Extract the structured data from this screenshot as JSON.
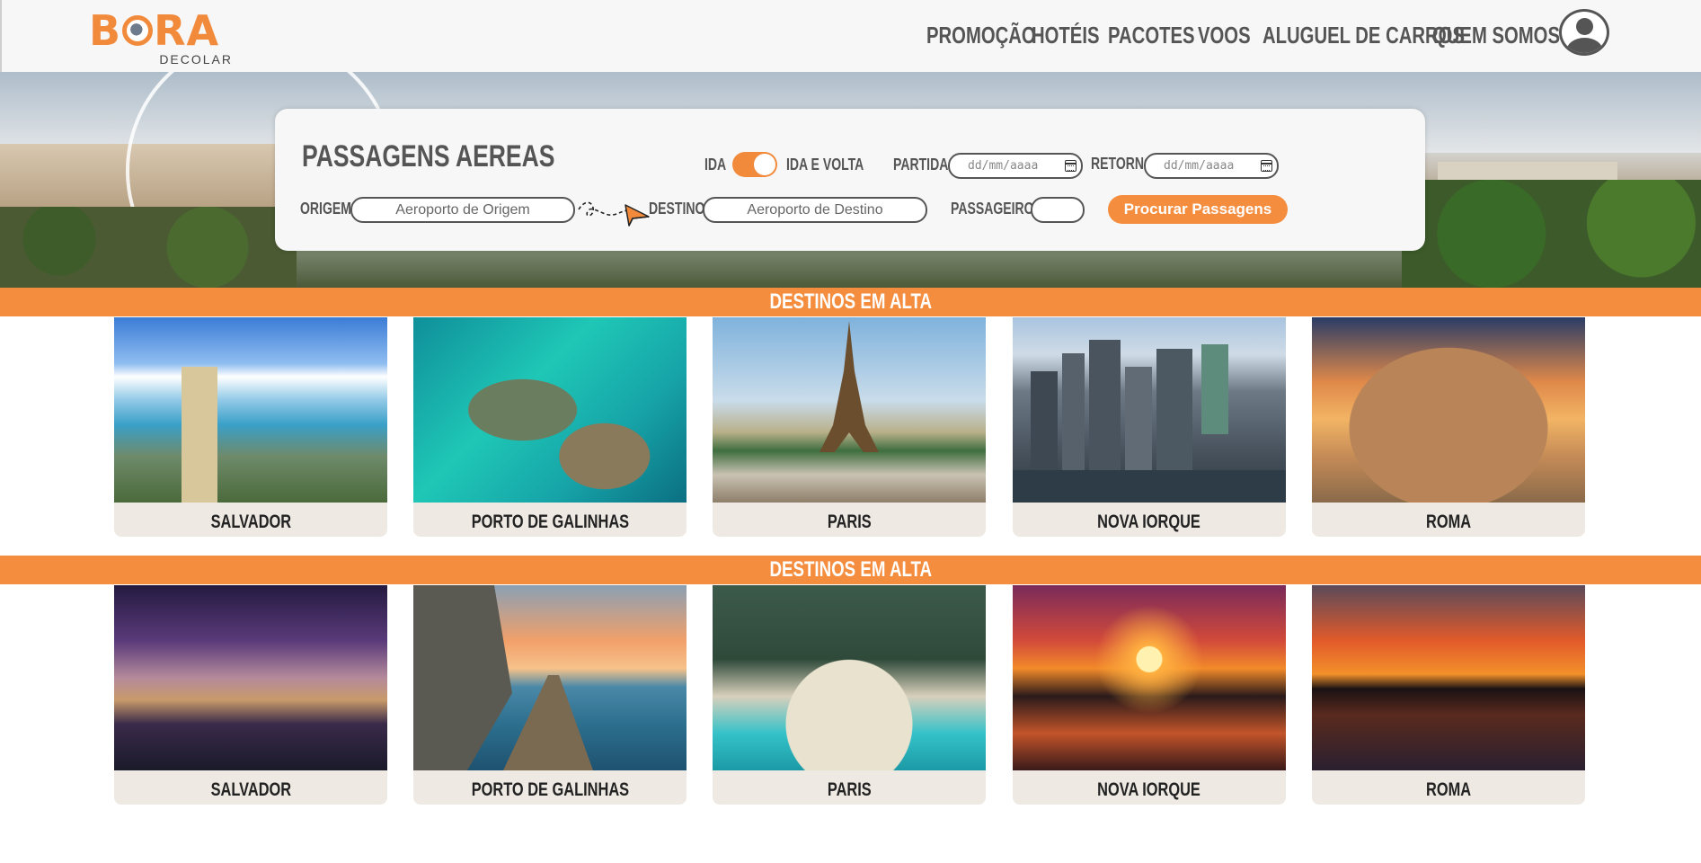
{
  "header": {
    "logo_main_a": "B",
    "logo_main_b": "RA",
    "logo_sub": "DECOLAR",
    "nav": [
      {
        "label": "PROMOÇÃO"
      },
      {
        "label": "HOTÉIS"
      },
      {
        "label": "PACOTES"
      },
      {
        "label": "VOOS"
      },
      {
        "label": "ALUGUEL DE CARROS"
      },
      {
        "label": "QUEM SOMOS"
      }
    ],
    "avatar_icon": "user-icon"
  },
  "search": {
    "title": "PASSAGENS AEREAS",
    "ida_label": "IDA",
    "ida_volta_label": "IDA E VOLTA",
    "toggle_on": true,
    "partida_label": "PARTIDA",
    "partida_placeholder": "dd/mm/aaaa",
    "retorno_label": "RETORNO",
    "retorno_placeholder": "dd/mm/aaaa",
    "origem_label": "ORIGEM",
    "origem_placeholder": "Aeroporto de Origem",
    "destino_label": "DESTINO",
    "destino_placeholder": "Aeroporto de Destino",
    "passageiros_label": "PASSAGEIROS",
    "passageiros_value": "",
    "button_label": "Procurar Passagens"
  },
  "sections": [
    {
      "title": "DESTINOS EM ALTA",
      "cards": [
        {
          "label": "SALVADOR",
          "image": "salvador-elevator-photo"
        },
        {
          "label": "PORTO DE GALINHAS",
          "image": "reef-aerial-photo"
        },
        {
          "label": "PARIS",
          "image": "eiffel-tower-photo"
        },
        {
          "label": "NOVA IORQUE",
          "image": "new-york-skyline-photo"
        },
        {
          "label": "ROMA",
          "image": "colosseum-photo"
        }
      ]
    },
    {
      "title": "DESTINOS EM ALTA",
      "cards": [
        {
          "label": "SALVADOR",
          "image": "castle-night-photo"
        },
        {
          "label": "PORTO DE GALINHAS",
          "image": "pier-sunset-photo"
        },
        {
          "label": "PARIS",
          "image": "tropical-bay-photo"
        },
        {
          "label": "NOVA IORQUE",
          "image": "palm-sunset-photo"
        },
        {
          "label": "ROMA",
          "image": "city-sunset-photo"
        }
      ]
    }
  ],
  "colors": {
    "accent": "#f58d3f",
    "text": "#555555",
    "card_bg": "#efe9e3"
  }
}
